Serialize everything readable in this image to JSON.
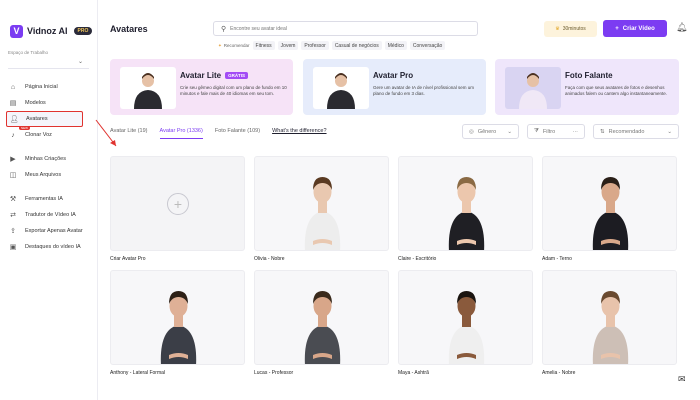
{
  "app": {
    "name": "Vidnoz AI",
    "plan_badge": "PRO"
  },
  "sidebar": {
    "workspace_label": "Espaço de Trabalho",
    "new_badge": "NEW",
    "items": [
      {
        "label": "Página Inicial",
        "icon": "home-icon"
      },
      {
        "label": "Modelos",
        "icon": "template-icon"
      },
      {
        "label": "Avatares",
        "icon": "avatar-icon",
        "active": true
      },
      {
        "label": "Clonar Voz",
        "icon": "voice-icon"
      },
      {
        "label": "Minhas Criações",
        "icon": "video-icon"
      },
      {
        "label": "Meus Arquivos",
        "icon": "folder-icon"
      },
      {
        "label": "Ferramentas IA",
        "icon": "tools-icon"
      },
      {
        "label": "Tradutor de Vídeo IA",
        "icon": "translate-icon"
      },
      {
        "label": "Exportar Apenas Avatar",
        "icon": "export-icon"
      },
      {
        "label": "Destaques do vídeo IA",
        "icon": "highlight-icon"
      }
    ]
  },
  "header": {
    "title": "Avatares",
    "search_placeholder": "Encontre seu avatar ideal",
    "recommend_label": "Recomendar",
    "chips": [
      "Fitness",
      "Jovem",
      "Professor",
      "Casual de negócios",
      "Médico",
      "Conversação"
    ],
    "minutes": "30minutos",
    "create_button": "Criar Vídeo"
  },
  "banners": [
    {
      "title": "Avatar Lite",
      "badge": "GRÁTIS",
      "desc": "Crie seu gêmeo digital com um plano de fundo em 10 minutos e fale mais de 40 idiomas em seu tom.",
      "color": "#f6e3f7"
    },
    {
      "title": "Avatar Pro",
      "badge": "",
      "desc": "Gere um avatar de IA de nível profissional sem um plano de fundo em 3 dias.",
      "color": "#e6ecfb"
    },
    {
      "title": "Foto Falante",
      "badge": "",
      "desc": "Faça com que seus avatares de fotos e desenhos animados falem ou cantem algo instantaneamente.",
      "color": "#efe6fb"
    }
  ],
  "tabs": [
    {
      "label": "Avatar Lite (19)",
      "active": false
    },
    {
      "label": "Avatar Pro (1336)",
      "active": true
    },
    {
      "label": "Foto Falante (109)",
      "active": false
    },
    {
      "label": "What's the difference?",
      "link": true
    }
  ],
  "filters": {
    "gender": "Gênero",
    "filter": "Filtro",
    "sort": "Recomendado"
  },
  "avatars": [
    {
      "name": "Criar Avatar Pro",
      "create": true
    },
    {
      "name": "Olivia - Nobre",
      "suit": "#ededed",
      "skin": "#e9c8b0",
      "hair": "#5a3a22"
    },
    {
      "name": "Claire - Escritório",
      "suit": "#1f1f24",
      "skin": "#ecc7ad",
      "hair": "#8a6a44"
    },
    {
      "name": "Adam - Terno",
      "suit": "#1c1c22",
      "skin": "#d9a88a",
      "hair": "#2a1f18"
    },
    {
      "name": "Anthony - Lateral Formal",
      "suit": "#3b3e47",
      "skin": "#dfb096",
      "hair": "#2d2016"
    },
    {
      "name": "Lucas - Professor",
      "suit": "#4a4c52",
      "skin": "#d8a689",
      "hair": "#3a2a1c"
    },
    {
      "name": "Maya - Ashtrã",
      "suit": "#efefef",
      "skin": "#8a5a3c",
      "hair": "#1a1410"
    },
    {
      "name": "Amelia - Nobre",
      "suit": "#cdbfb6",
      "skin": "#e8c3ab",
      "hair": "#6a4a30"
    }
  ]
}
